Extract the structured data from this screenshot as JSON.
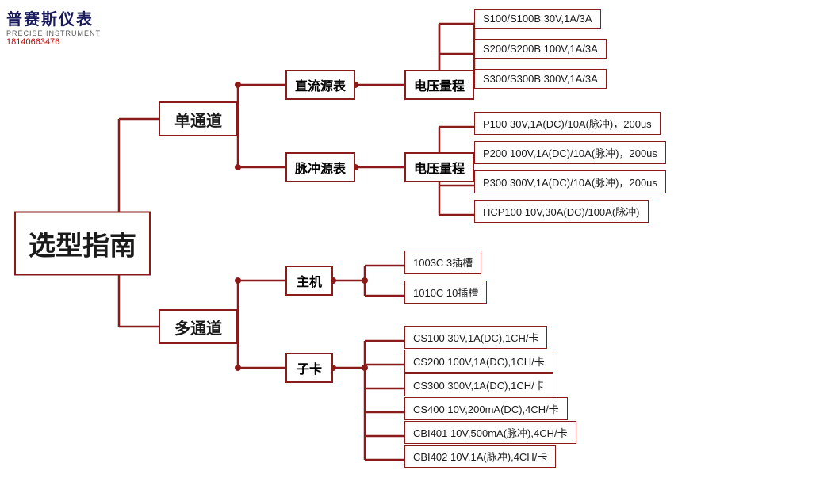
{
  "logo": {
    "cn": "普赛斯仪表",
    "en": "PRECISE INSTRUMENT",
    "phone": "18140663476"
  },
  "title": "选型指南",
  "nodes": {
    "single_channel": "单通道",
    "multi_channel": "多通道",
    "dc_source": "直流源表",
    "pulse_source": "脉冲源表",
    "dc_voltage": "电压量程",
    "pulse_voltage": "电压量程",
    "mainframe": "主机",
    "subcard": "子卡"
  },
  "leaves": {
    "dc": [
      {
        "model": "S100/S100B",
        "spec": "30V,1A/3A"
      },
      {
        "model": "S200/S200B",
        "spec": "100V,1A/3A"
      },
      {
        "model": "S300/S300B",
        "spec": "300V,1A/3A"
      }
    ],
    "pulse": [
      {
        "model": "P100",
        "spec": "30V,1A(DC)/10A(脉冲)，200us"
      },
      {
        "model": "P200",
        "spec": "100V,1A(DC)/10A(脉冲)，200us"
      },
      {
        "model": "P300",
        "spec": "300V,1A(DC)/10A(脉冲)，200us"
      },
      {
        "model": "HCP100",
        "spec": "10V,30A(DC)/100A(脉冲)"
      }
    ],
    "mainframe": [
      {
        "model": "1003C",
        "spec": "3插槽"
      },
      {
        "model": "1010C",
        "spec": "10插槽"
      }
    ],
    "subcard": [
      {
        "model": "CS100",
        "spec": "30V,1A(DC),1CH/卡"
      },
      {
        "model": "CS200",
        "spec": "100V,1A(DC),1CH/卡"
      },
      {
        "model": "CS300",
        "spec": "300V,1A(DC),1CH/卡"
      },
      {
        "model": "CS400",
        "spec": "10V,200mA(DC),4CH/卡"
      },
      {
        "model": "CBI401",
        "spec": "10V,500mA(脉冲),4CH/卡"
      },
      {
        "model": "CBI402",
        "spec": "10V,1A(脉冲),4CH/卡"
      }
    ]
  },
  "colors": {
    "branch": "#8b1a1a",
    "text_dark": "#1a1a1a",
    "text_blue": "#1a1a5e",
    "text_red": "#cc0000"
  }
}
